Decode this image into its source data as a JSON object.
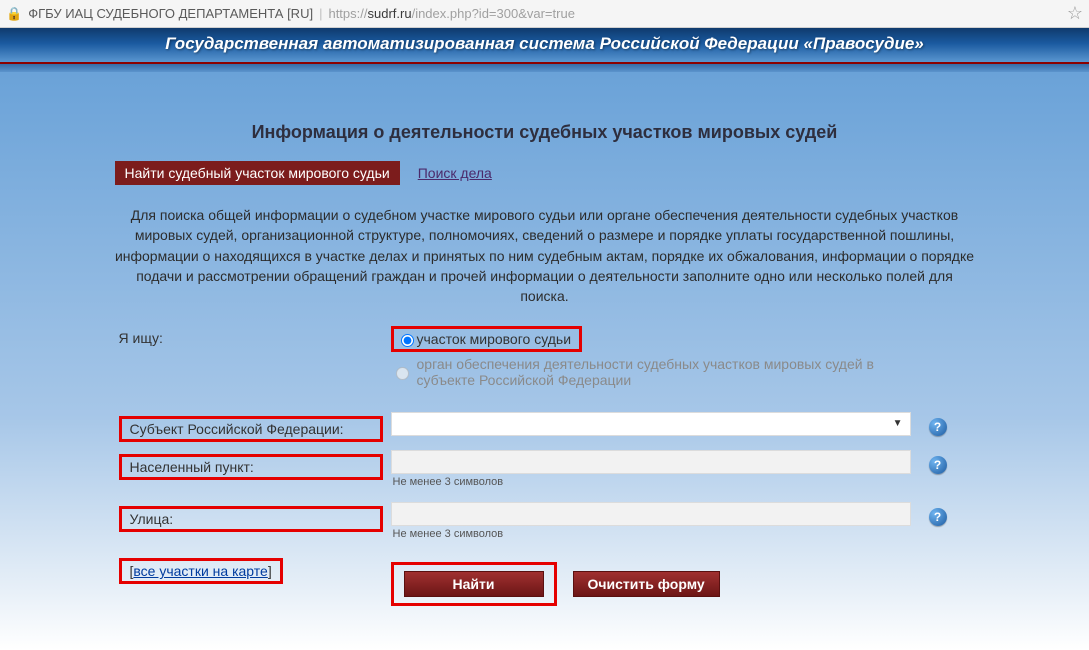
{
  "browser": {
    "org": "ФГБУ ИАЦ СУДЕБНОГО ДЕПАРТАМЕНТА [RU]",
    "url_prefix": "https://",
    "url_host": "sudrf.ru",
    "url_path": "/index.php?id=300&var=true"
  },
  "banner": "Государственная автоматизированная система Российской Федерации «Правосудие»",
  "page_title": "Информация о деятельности судебных участков мировых судей",
  "tabs": {
    "active": "Найти судебный участок мирового судьи",
    "other": "Поиск дела"
  },
  "intro": "Для поиска общей информации о судебном участке мирового судьи или органе обеспечения деятельности судебных участков мировых судей, организационной структуре, полномочиях, сведений о размере и порядке уплаты государственной пошлины, информации о находящихся в участке делах и принятых по ним судебным актам, порядке их обжалования, информации о порядке подачи и рассмотрении обращений граждан и прочей информации о деятельности заполните одно или несколько полей для поиска.",
  "form": {
    "i_search_label": "Я ищу:",
    "radio1": "участок мирового судьи",
    "radio2": "орган обеспечения деятельности судебных участков мировых судей в субъекте Российской Федерации",
    "subject_label": "Субъект Российской Федерации:",
    "city_label": "Населенный пункт:",
    "street_label": "Улица:",
    "hint_min": "Не менее 3 символов",
    "map_link": "все участки на карте",
    "find_btn": "Найти",
    "clear_btn": "Очистить форму"
  }
}
